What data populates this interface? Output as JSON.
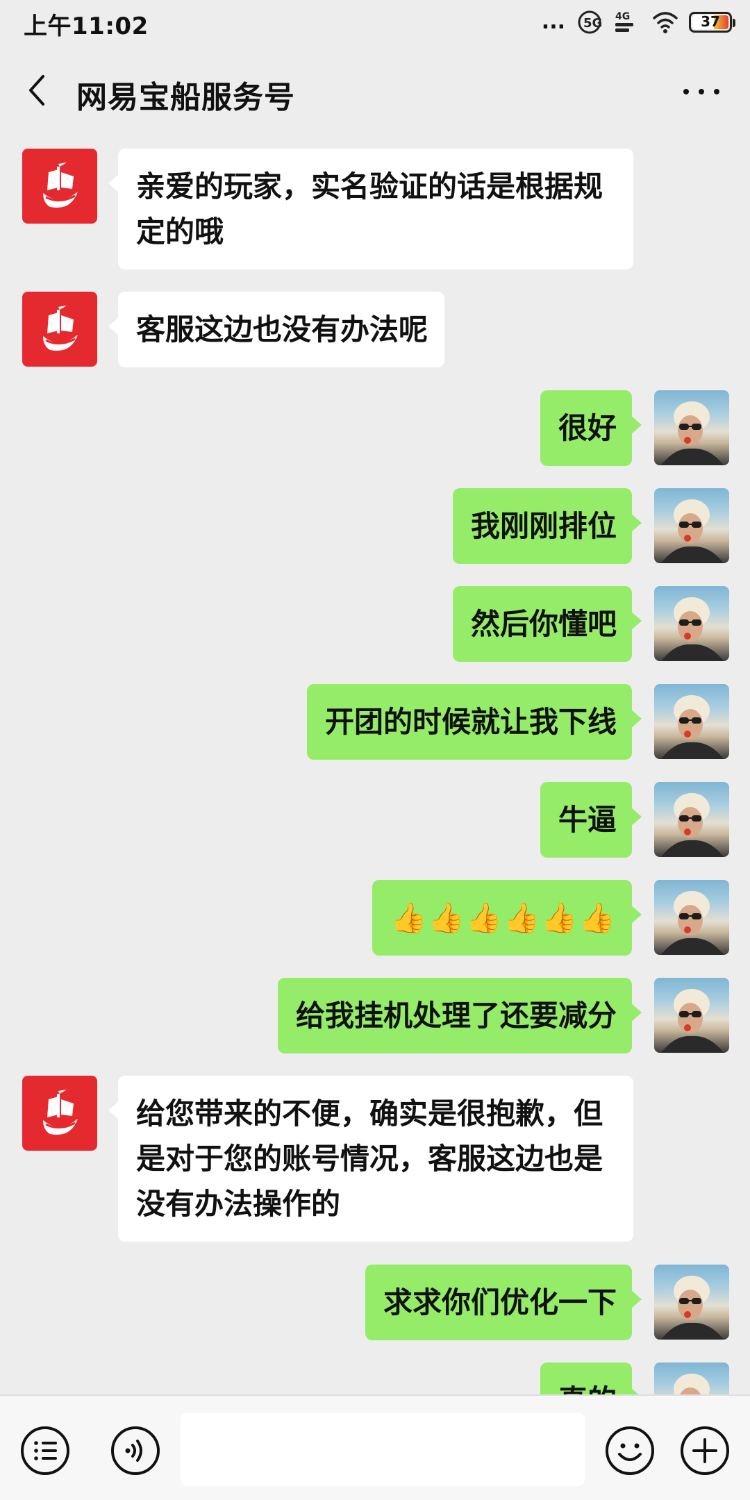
{
  "status_bar": {
    "time": "上午11:02",
    "dots": "...",
    "sim_badge": "5G",
    "network_badge": "4G",
    "battery_level": "37",
    "icons": [
      "dots-icon",
      "sim-icon",
      "signal-icon",
      "wifi-icon",
      "battery-icon"
    ]
  },
  "header": {
    "title": "网易宝船服务号",
    "back_icon": "chevron-left-icon",
    "more_icon": "more-horizontal-icon"
  },
  "messages": [
    {
      "side": "left",
      "text": "亲爱的玩家，实名验证的话是根据规定的哦"
    },
    {
      "side": "left",
      "text": "客服这边也没有办法呢"
    },
    {
      "side": "right",
      "text": "很好"
    },
    {
      "side": "right",
      "text": "我刚刚排位"
    },
    {
      "side": "right",
      "text": "然后你懂吧"
    },
    {
      "side": "right",
      "text": "开团的时候就让我下线"
    },
    {
      "side": "right",
      "text": "牛逼"
    },
    {
      "side": "right",
      "text": "👍👍👍👍👍👍"
    },
    {
      "side": "right",
      "text": "给我挂机处理了还要减分"
    },
    {
      "side": "left",
      "text": "给您带来的不便，确实是很抱歉，但是对于您的账号情况，客服这边也是没有办法操作的"
    },
    {
      "side": "right",
      "text": "求求你们优化一下"
    },
    {
      "side": "right",
      "text": "真的"
    }
  ],
  "input_bar": {
    "menu_icon": "list-menu-icon",
    "voice_icon": "voice-icon",
    "emoji_icon": "emoji-icon",
    "add_icon": "plus-icon",
    "text_value": ""
  },
  "colors": {
    "background": "#ededed",
    "bubble_self": "#95ec69",
    "bubble_other": "#ffffff",
    "brand_avatar": "#e52a2f"
  }
}
